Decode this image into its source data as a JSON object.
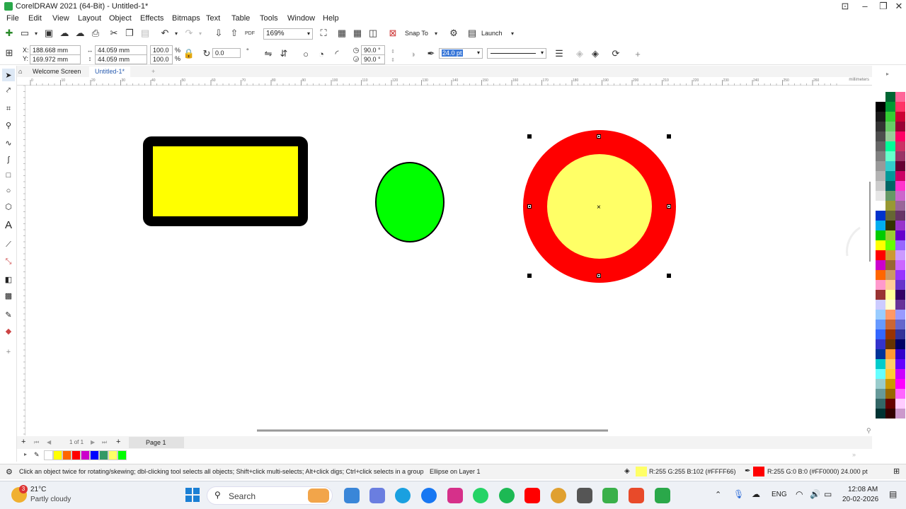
{
  "window": {
    "title": "CorelDRAW 2021 (64-Bit) - Untitled-1*"
  },
  "menu": [
    "File",
    "Edit",
    "View",
    "Layout",
    "Object",
    "Effects",
    "Bitmaps",
    "Text",
    "Table",
    "Tools",
    "Window",
    "Help"
  ],
  "toolbar": {
    "zoom_value": "169%",
    "snap_to_label": "Snap To",
    "launch_label": "Launch",
    "pdf_label": "PDF"
  },
  "property_bar": {
    "x_label": "X:",
    "x_value": "188.668 mm",
    "y_label": "Y:",
    "y_value": "169.972 mm",
    "width_value": "44.059 mm",
    "height_value": "44.059 mm",
    "scale_x": "100.0",
    "scale_y": "100.0",
    "percent": "%",
    "rotation": "0.0",
    "start_angle": "90.0 °",
    "end_angle": "90.0 °",
    "outline_width": "24.0 pt"
  },
  "tabs": [
    "Welcome Screen",
    "Untitled-1*"
  ],
  "ruler": {
    "unit": "millimeters",
    "h_ticks": [
      "0",
      "10",
      "20",
      "30",
      "40",
      "50",
      "60",
      "70",
      "80",
      "90",
      "100",
      "110",
      "120",
      "130",
      "140",
      "150",
      "160",
      "170",
      "180",
      "190",
      "200",
      "210",
      "220",
      "230",
      "240",
      "250",
      "260"
    ]
  },
  "colors": {
    "rect_fill": "#ffff00",
    "rect_stroke": "#000000",
    "ellipse_fill": "#00ff00",
    "ellipse_stroke": "#000000",
    "circle_fill": "#ffff66",
    "circle_stroke": "#ff0000"
  },
  "page_nav": {
    "counter": "1",
    "of_label": "of",
    "total": "1",
    "page_tab": "Page 1"
  },
  "status": {
    "hint": "Click an object twice for rotating/skewing; dbl-clicking tool selects all objects; Shift+click multi-selects; Alt+click digs; Ctrl+click selects in a group",
    "object_info": "Ellipse on Layer 1",
    "fill_info": "R:255 G:255 B:102 (#FFFF66)",
    "outline_info": "R:255 G:0 B:0 (#FF0000)  24.000 pt"
  },
  "taskbar": {
    "weather_temp": "21°C",
    "weather_desc": "Partly cloudy",
    "weather_badge": "3",
    "search_label": "Search",
    "language": "ENG",
    "time": "12:08 AM",
    "date": "20-02-2026"
  }
}
